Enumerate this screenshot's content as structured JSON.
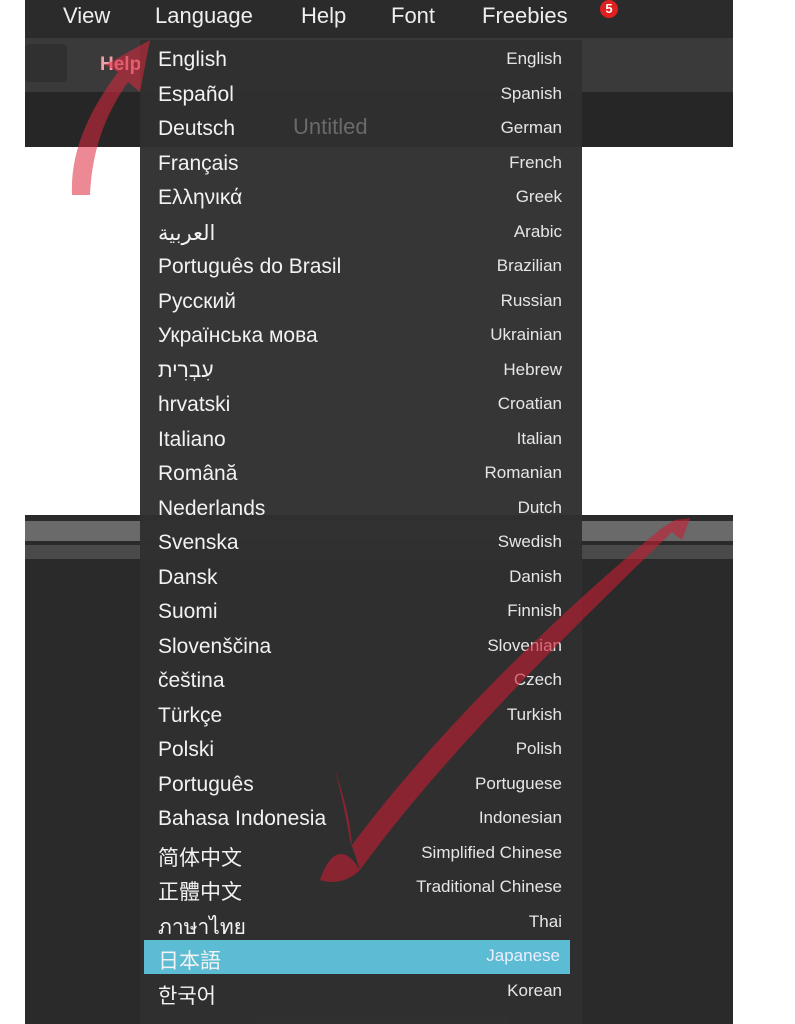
{
  "menubar": {
    "items": [
      "View",
      "Language",
      "Help",
      "Font",
      "Freebies"
    ],
    "badge": "5"
  },
  "toolbar": {
    "help_label": "Help"
  },
  "titlebar": {
    "title": "Untitled"
  },
  "accent": "#5bbcd4",
  "language_menu": {
    "selected": "日本語",
    "items": [
      {
        "native": "English",
        "english": "English"
      },
      {
        "native": "Español",
        "english": "Spanish"
      },
      {
        "native": "Deutsch",
        "english": "German"
      },
      {
        "native": "Français",
        "english": "French"
      },
      {
        "native": "Ελληνικά",
        "english": "Greek"
      },
      {
        "native": "العربية",
        "english": "Arabic"
      },
      {
        "native": "Português do Brasil",
        "english": "Brazilian"
      },
      {
        "native": "Русский",
        "english": "Russian"
      },
      {
        "native": "Українська мова",
        "english": "Ukrainian"
      },
      {
        "native": "עִבְרִית",
        "english": "Hebrew"
      },
      {
        "native": "hrvatski",
        "english": "Croatian"
      },
      {
        "native": "Italiano",
        "english": "Italian"
      },
      {
        "native": "Română",
        "english": "Romanian"
      },
      {
        "native": "Nederlands",
        "english": "Dutch"
      },
      {
        "native": "Svenska",
        "english": "Swedish"
      },
      {
        "native": "Dansk",
        "english": "Danish"
      },
      {
        "native": "Suomi",
        "english": "Finnish"
      },
      {
        "native": "Slovenščina",
        "english": "Slovenian"
      },
      {
        "native": "čeština",
        "english": "Czech"
      },
      {
        "native": "Türkçe",
        "english": "Turkish"
      },
      {
        "native": "Polski",
        "english": "Polish"
      },
      {
        "native": "Português",
        "english": "Portuguese"
      },
      {
        "native": "Bahasa Indonesia",
        "english": "Indonesian"
      },
      {
        "native": "简体中文",
        "english": "Simplified Chinese"
      },
      {
        "native": "正體中文",
        "english": "Traditional Chinese"
      },
      {
        "native": "ภาษาไทย",
        "english": "Thai"
      },
      {
        "native": "日本語",
        "english": "Japanese"
      },
      {
        "native": "한국어",
        "english": "Korean"
      }
    ]
  }
}
